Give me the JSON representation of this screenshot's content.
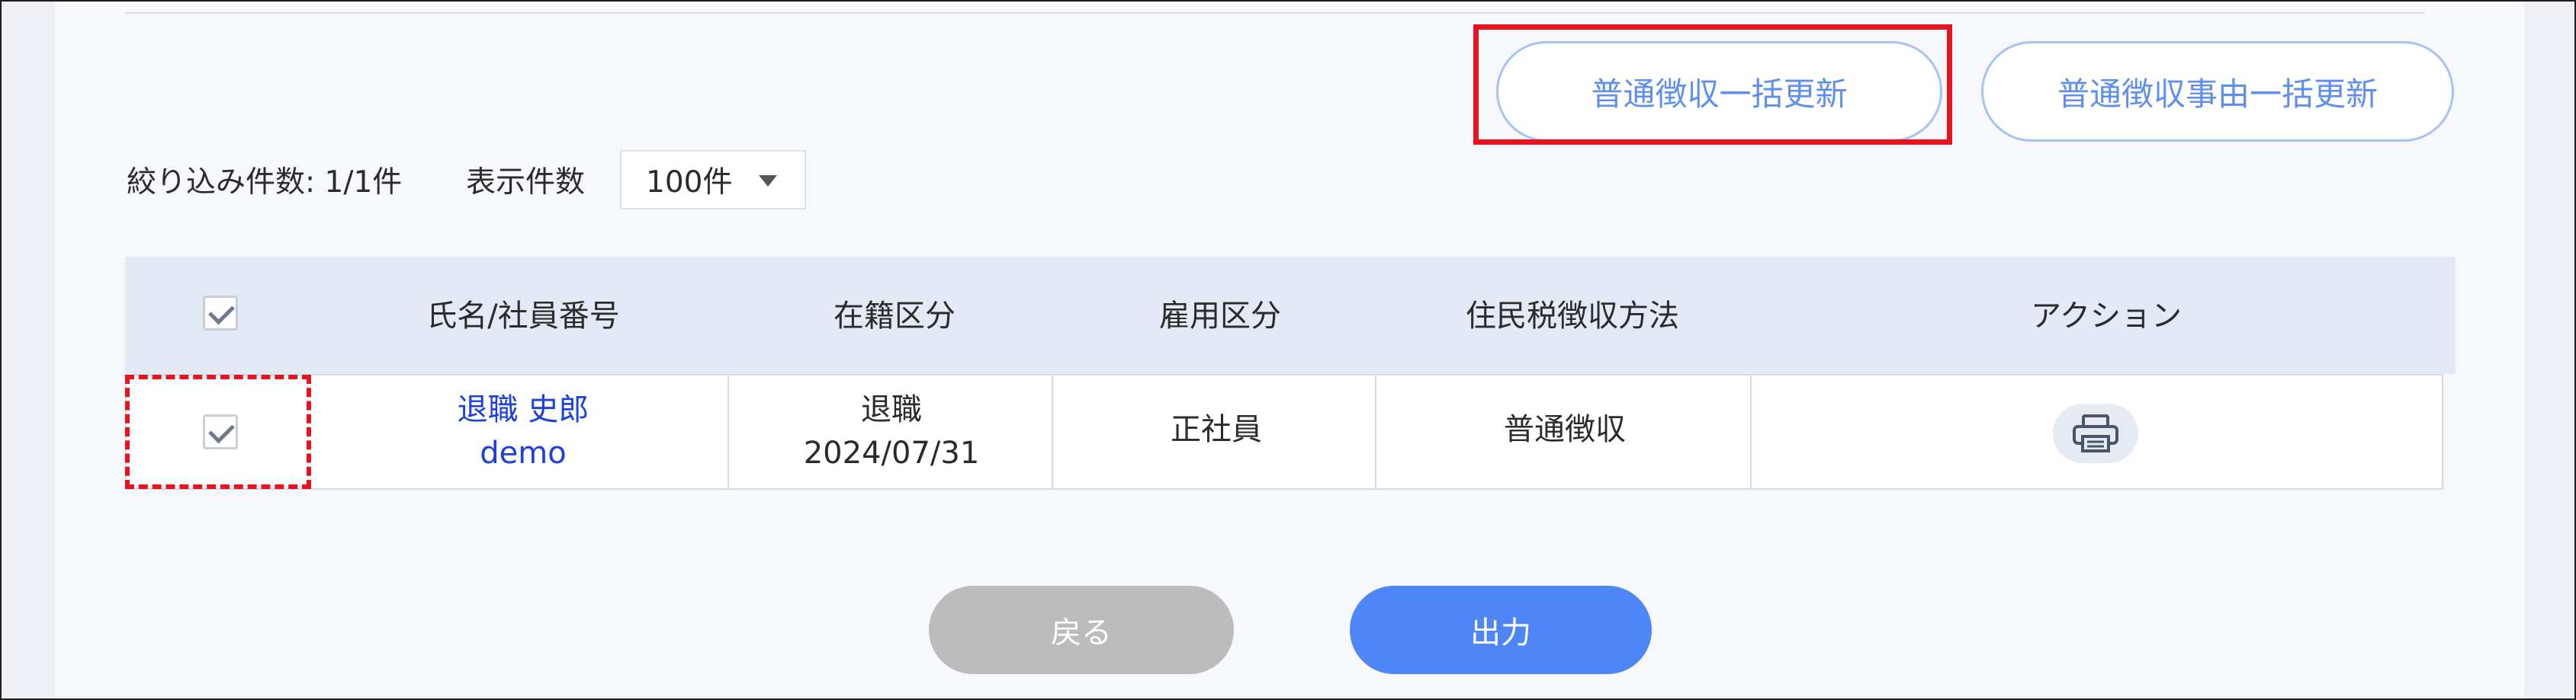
{
  "toolbar": {
    "bulk_normal_label": "普通徴収一括更新",
    "bulk_reason_label": "普通徴収事由一括更新"
  },
  "filter": {
    "count_text": "絞り込み件数: 1/1件",
    "display_label": "表示件数",
    "display_value": "100件"
  },
  "table": {
    "headers": [
      "氏名/社員番号",
      "在籍区分",
      "雇用区分",
      "住民税徴収方法",
      "アクション"
    ],
    "rows": [
      {
        "checked": true,
        "name": "退職 史郎",
        "employee_no": "demo",
        "status": "退職",
        "status_date": "2024/07/31",
        "employment_type": "正社員",
        "tax_method": "普通徴収",
        "action_icon": "printer-icon"
      }
    ]
  },
  "footer": {
    "back_label": "戻る",
    "output_label": "出力"
  },
  "colors": {
    "accent": "#4f86f7",
    "link": "#1b3fe0",
    "highlight": "#e8141d",
    "header_bg": "#e4e9f6"
  }
}
